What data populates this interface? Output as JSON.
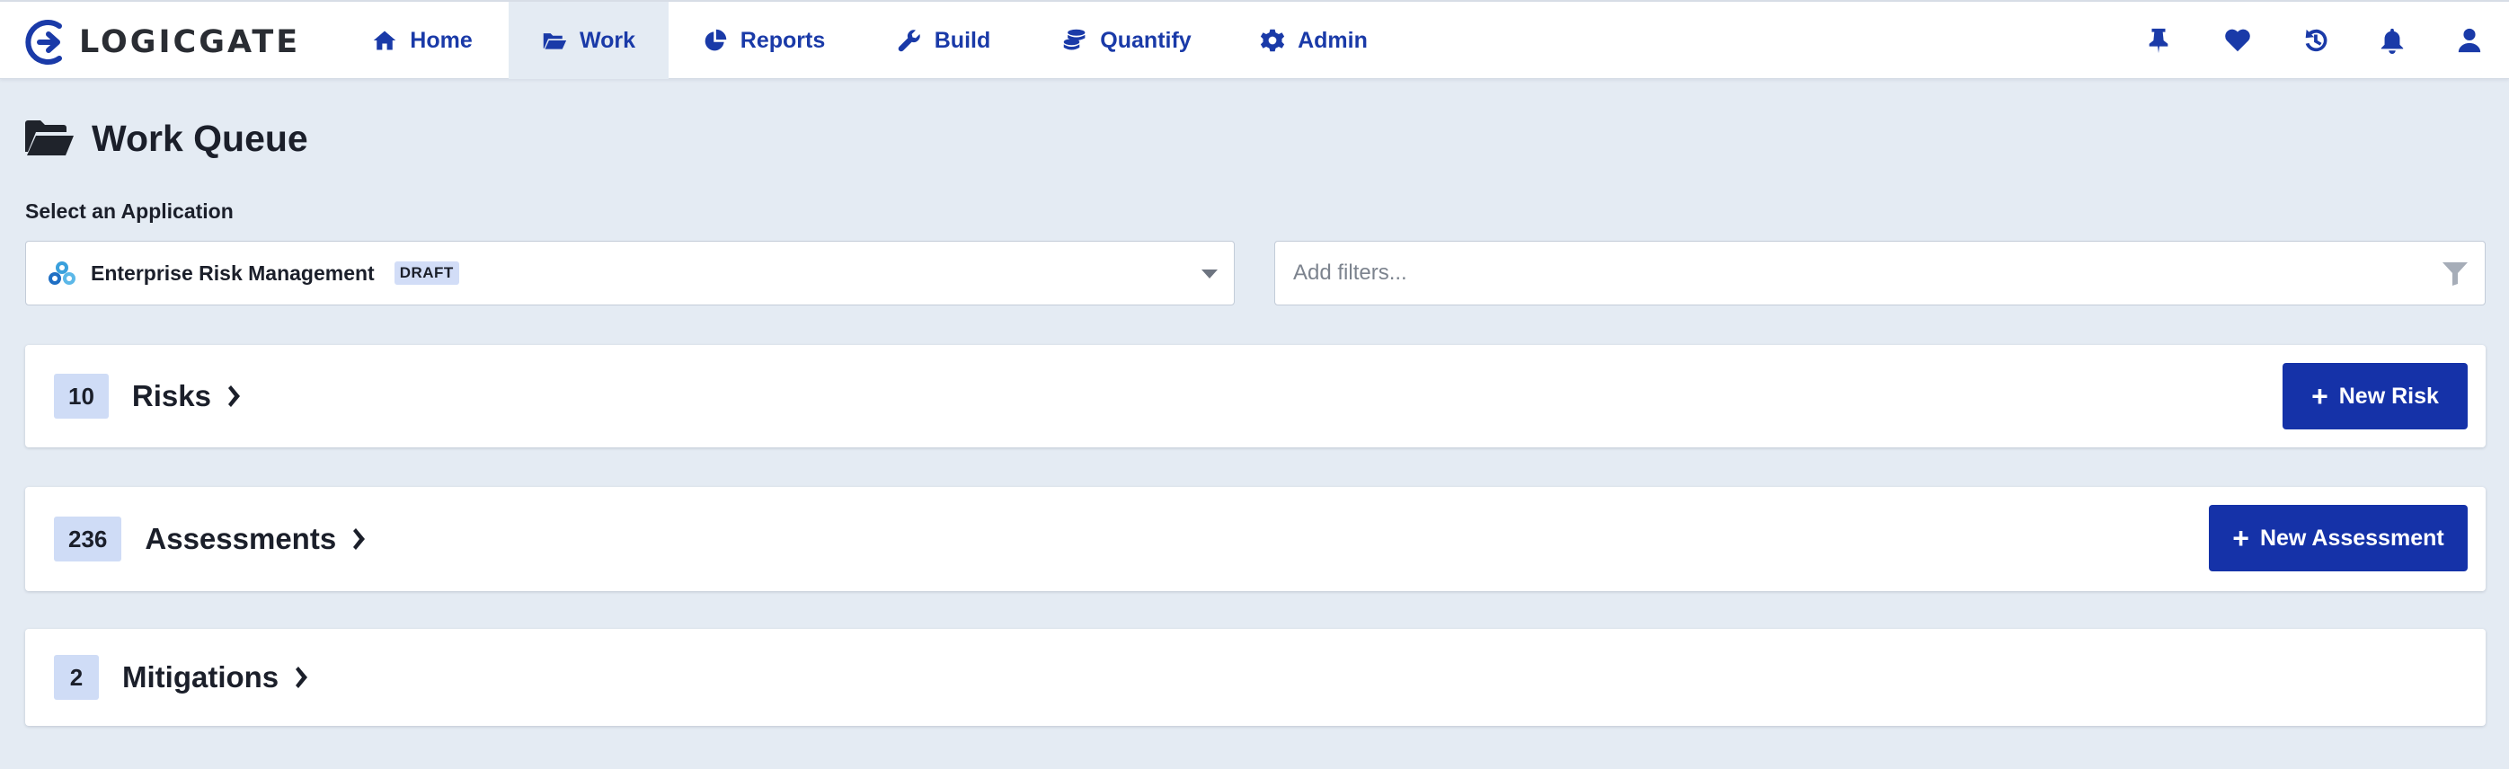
{
  "brand": {
    "name": "LOGICGATE",
    "colors": {
      "primary": "#1532a8",
      "nav_text": "#1a3aa8",
      "background": "#e4ebf3",
      "badge": "#cfdcf6"
    }
  },
  "nav": {
    "items": [
      {
        "label": "Home",
        "icon": "home-icon"
      },
      {
        "label": "Work",
        "icon": "folder-open-icon",
        "active": true
      },
      {
        "label": "Reports",
        "icon": "pie-chart-icon"
      },
      {
        "label": "Build",
        "icon": "wrench-icon"
      },
      {
        "label": "Quantify",
        "icon": "coins-icon"
      },
      {
        "label": "Admin",
        "icon": "gear-icon"
      }
    ],
    "right_icons": [
      "pin-icon",
      "heart-icon",
      "history-icon",
      "bell-icon",
      "user-icon"
    ]
  },
  "page": {
    "title": "Work Queue",
    "select_label": "Select an Application"
  },
  "application_select": {
    "value": "Enterprise Risk Management",
    "badge": "DRAFT"
  },
  "filters": {
    "placeholder": "Add filters..."
  },
  "queues": [
    {
      "count": "10",
      "title": "Risks",
      "button": "New Risk"
    },
    {
      "count": "236",
      "title": "Assessments",
      "button": "New Assessment"
    },
    {
      "count": "2",
      "title": "Mitigations",
      "button": ""
    }
  ]
}
